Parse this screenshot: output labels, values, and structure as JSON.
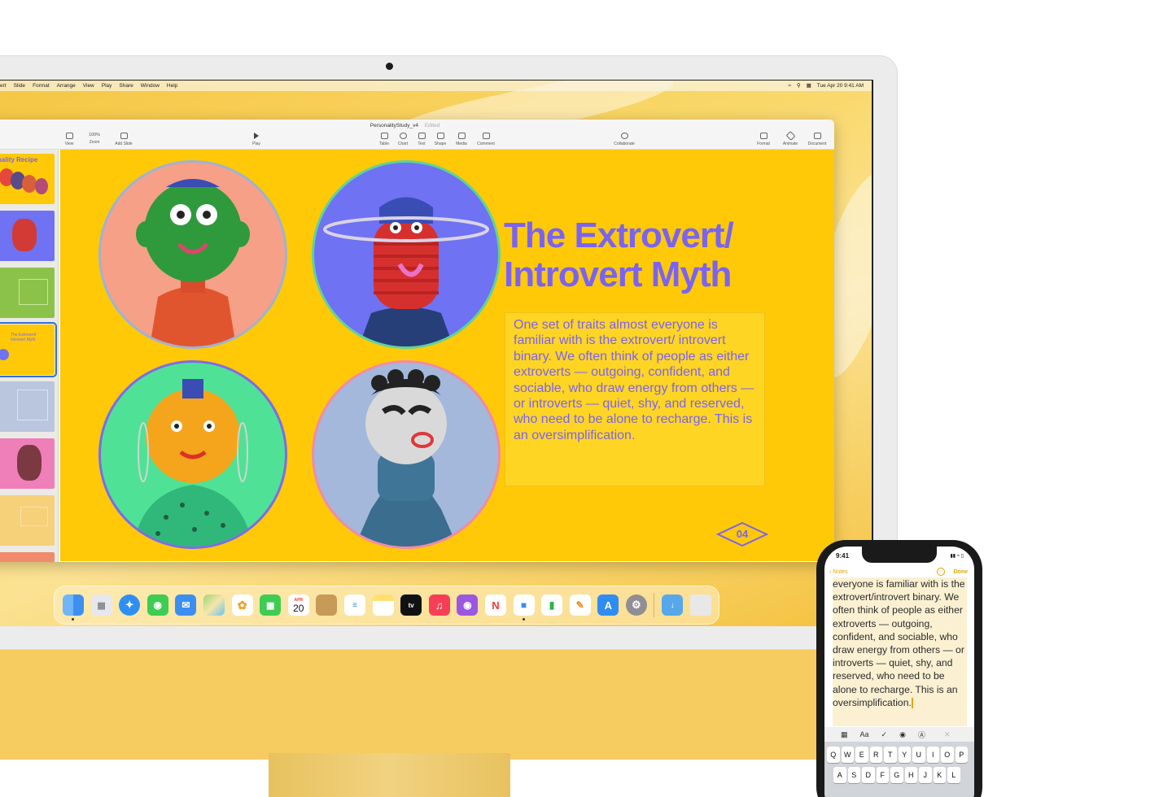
{
  "menubar": {
    "items": [
      "ert",
      "Slide",
      "Format",
      "Arrange",
      "View",
      "Play",
      "Share",
      "Window",
      "Help"
    ],
    "clock": "Tue Apr 20  9:41 AM",
    "icons": [
      "wifi-icon",
      "search-icon",
      "control-center-icon"
    ]
  },
  "keynote": {
    "doc_title": "PersonalityStudy_v4",
    "doc_status": "Edited",
    "toolbar_left": [
      {
        "label": "View",
        "icon": "view-icon"
      },
      {
        "label": "Zoom",
        "value": "100%",
        "icon": "zoom-icon"
      },
      {
        "label": "Add Slide",
        "icon": "add-slide-icon"
      }
    ],
    "toolbar_play": {
      "label": "Play",
      "icon": "play-icon"
    },
    "toolbar_insert": [
      {
        "label": "Table",
        "icon": "table-icon"
      },
      {
        "label": "Chart",
        "icon": "chart-icon"
      },
      {
        "label": "Text",
        "icon": "text-icon"
      },
      {
        "label": "Shape",
        "icon": "shape-icon"
      },
      {
        "label": "Media",
        "icon": "media-icon"
      },
      {
        "label": "Comment",
        "icon": "comment-icon"
      }
    ],
    "toolbar_collaborate": {
      "label": "Collaborate",
      "icon": "collaborate-icon"
    },
    "toolbar_right": [
      {
        "label": "Format",
        "icon": "format-icon"
      },
      {
        "label": "Animate",
        "icon": "animate-icon"
      },
      {
        "label": "Document",
        "icon": "document-icon"
      }
    ],
    "navigator_first_title": "nality Recipe",
    "selected_thumb_text": "The Extrovert/ Introvert Myth"
  },
  "slide": {
    "title_line1": "The Extrovert/",
    "title_line2": "Introvert Myth",
    "body": "One set of traits almost everyone is familiar with is the extrovert/ introvert binary. We often think of people as either extroverts — outgoing, confident, and sociable, who draw energy from others — or introverts — quiet, shy, and reserved, who need to be alone to recharge. This is an oversimplification.",
    "number": "04",
    "colors": {
      "background": "#ffc907",
      "accent": "#7a63f2"
    }
  },
  "dock": {
    "apps": [
      {
        "name": "Finder",
        "color": "#3d8ff0",
        "text": ""
      },
      {
        "name": "Launchpad",
        "color": "#e7e7ef",
        "text": ""
      },
      {
        "name": "Safari",
        "color": "#2d8ff3",
        "text": ""
      },
      {
        "name": "Messages",
        "color": "#3fcc52",
        "text": ""
      },
      {
        "name": "Mail",
        "color": "#3b8ff1",
        "text": ""
      },
      {
        "name": "Maps",
        "color": "#9fd47a",
        "text": ""
      },
      {
        "name": "Photos",
        "color": "#ffffff",
        "text": ""
      },
      {
        "name": "FaceTime",
        "color": "#3fcc52",
        "text": ""
      },
      {
        "name": "Calendar",
        "color": "#ffffff",
        "text": "20",
        "month": "APR"
      },
      {
        "name": "Contacts",
        "color": "#c79a58",
        "text": ""
      },
      {
        "name": "Reminders",
        "color": "#ffffff",
        "text": ""
      },
      {
        "name": "Notes",
        "color": "#ffe071",
        "text": ""
      },
      {
        "name": "TV",
        "color": "#111111",
        "text": "tv"
      },
      {
        "name": "Music",
        "color": "#f63f57",
        "text": ""
      },
      {
        "name": "Podcasts",
        "color": "#9b57e0",
        "text": ""
      },
      {
        "name": "News",
        "color": "#ffffff",
        "text": ""
      },
      {
        "name": "Keynote",
        "color": "#ffffff",
        "text": ""
      },
      {
        "name": "Numbers",
        "color": "#ffffff",
        "text": ""
      },
      {
        "name": "Pages",
        "color": "#ffffff",
        "text": ""
      },
      {
        "name": "App Store",
        "color": "#2f8cf2",
        "text": ""
      },
      {
        "name": "System Preferences",
        "color": "#8f8f93",
        "text": ""
      }
    ],
    "folders": [
      {
        "name": "Downloads",
        "color": "#56a8ea"
      },
      {
        "name": "Trash",
        "color": "#e8e8e8"
      }
    ]
  },
  "iphone": {
    "time": "9:41",
    "back_label": "Notes",
    "done_label": "Done",
    "note_text": "everyone is familiar with is the extrovert/introvert binary. We often think of people as either extroverts — outgoing, confident, and sociable, who draw energy from others — or introverts — quiet, shy, and reserved, who need to be alone to recharge. This is an oversimplification.",
    "format_toolbar": [
      "table-icon",
      "Aa",
      "checklist-icon",
      "camera-icon",
      "markup-icon",
      "close-icon"
    ],
    "keyboard_row1": [
      "Q",
      "W",
      "E",
      "R",
      "T",
      "Y",
      "U",
      "I",
      "O",
      "P"
    ],
    "keyboard_row2": [
      "A",
      "S",
      "D",
      "F",
      "G",
      "H",
      "J",
      "K",
      "L"
    ]
  }
}
